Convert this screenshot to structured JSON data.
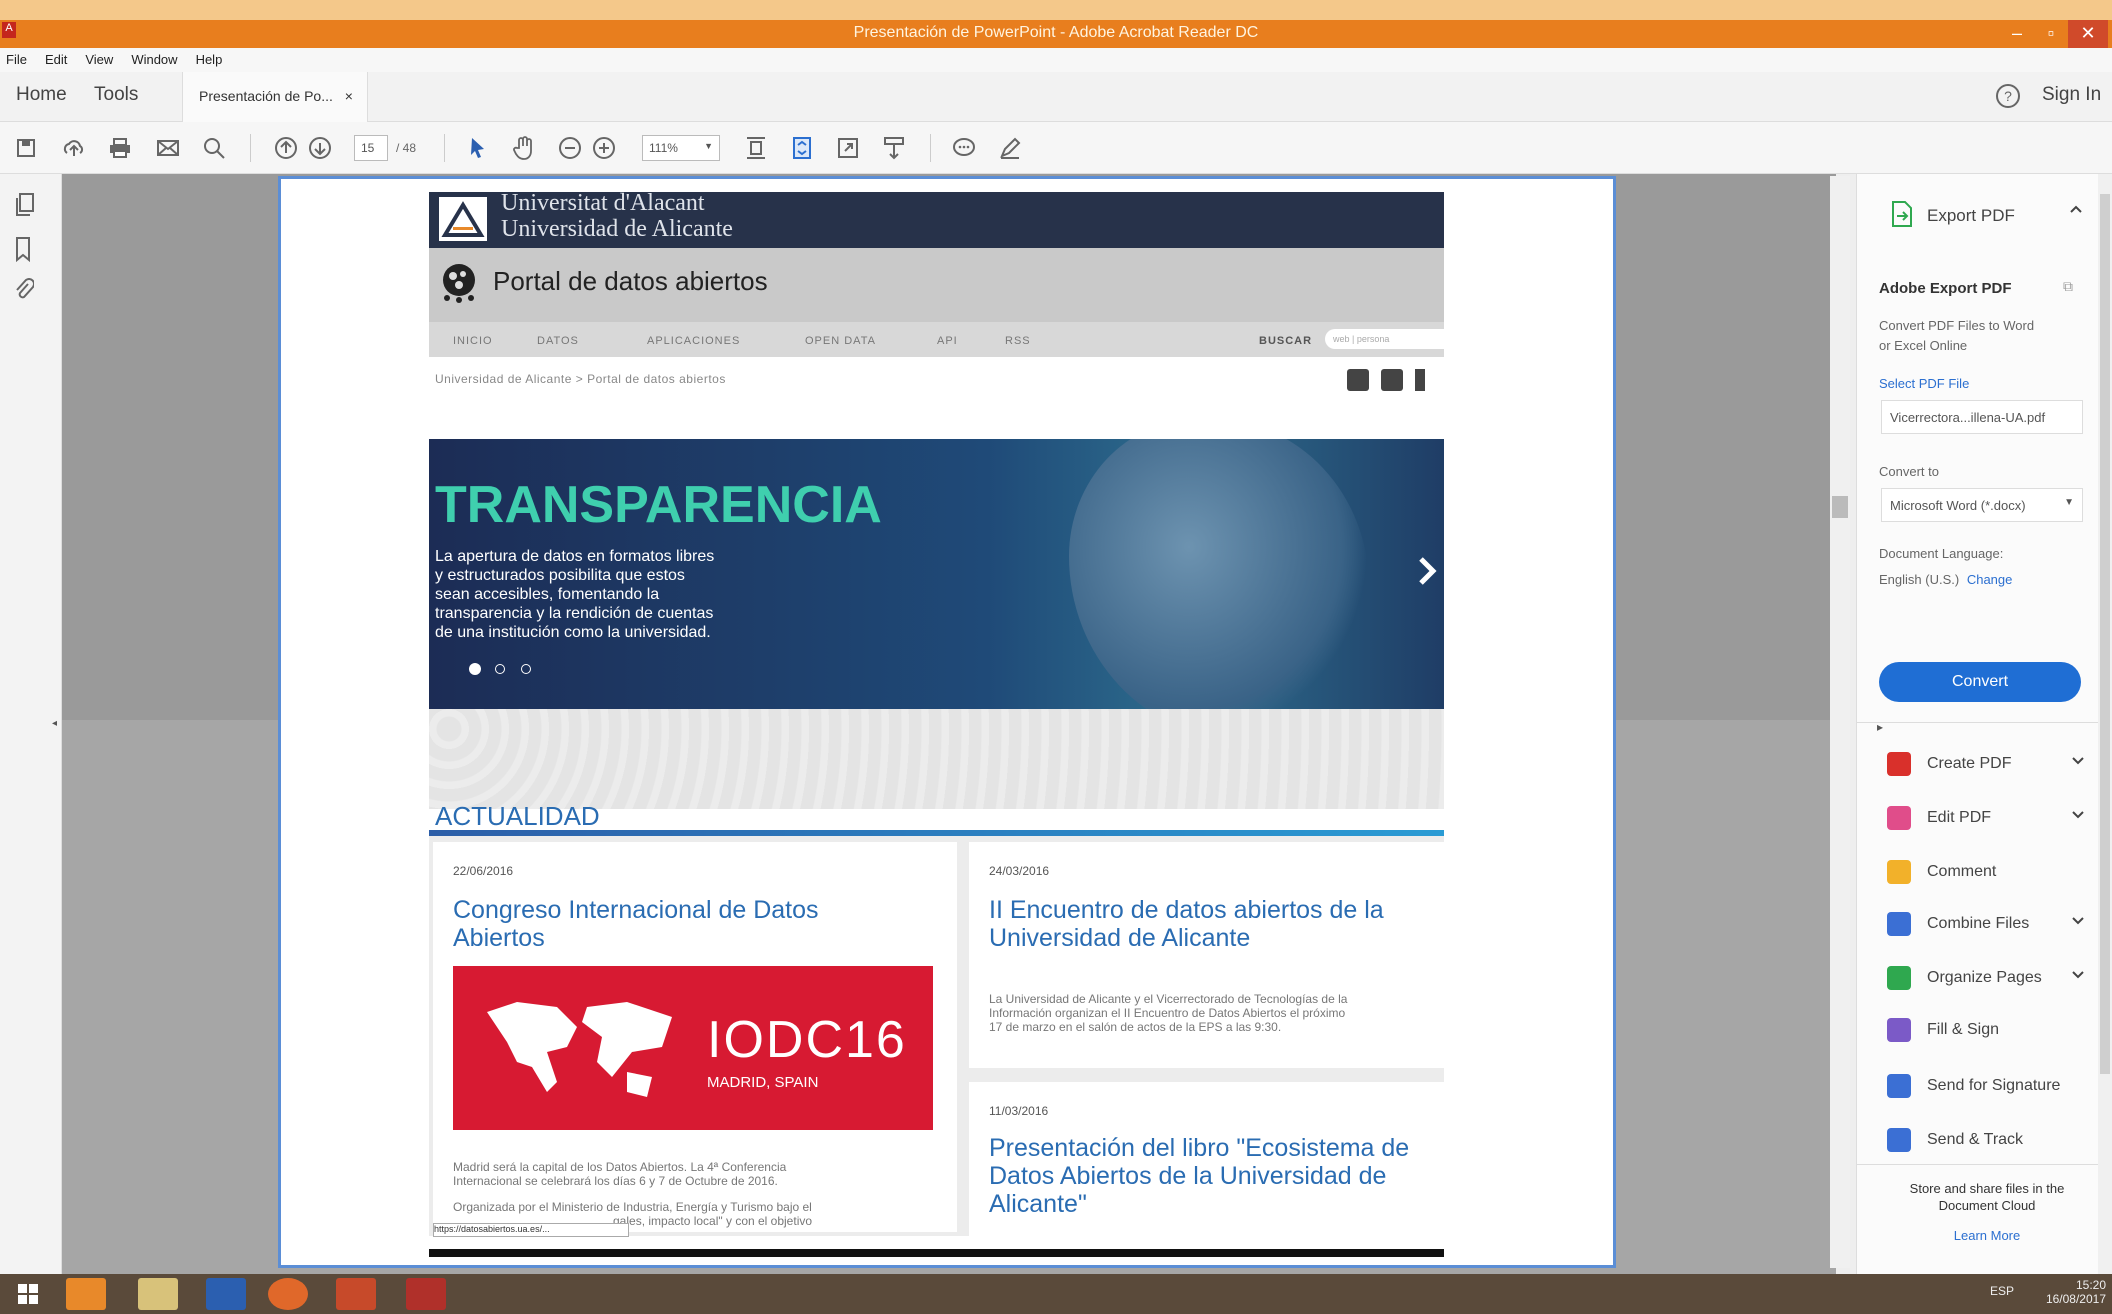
{
  "window": {
    "title": "Presentación de PowerPoint - Adobe Acrobat Reader DC",
    "min": "–",
    "max": "▫",
    "close": "✕"
  },
  "menu": [
    "File",
    "Edit",
    "View",
    "Window",
    "Help"
  ],
  "tabs": {
    "home": "Home",
    "tools": "Tools",
    "doc_tab": "Presentación de Po...",
    "doc_tab_close": "×",
    "help": "?",
    "signin": "Sign In"
  },
  "toolbar": {
    "page_current": "15",
    "page_total": "/ 48",
    "zoom": "111%"
  },
  "web": {
    "univ_line1": "Universitat d'Alacant",
    "univ_line2": "Universidad de Alicante",
    "portal_title": "Portal de datos abiertos",
    "nav": [
      "INICIO",
      "DATOS",
      "APLICACIONES",
      "OPEN DATA",
      "API",
      "RSS"
    ],
    "buscar": "BUSCAR",
    "search_placeholder": "web | persona",
    "breadcrumb": "Universidad de Alicante > Portal de datos abiertos",
    "hero_title": "TRANSPARENCIA",
    "hero_text": [
      "La apertura de datos en formatos libres",
      "y estructurados posibilita que estos",
      "sean accesibles, fomentando la",
      "transparencia y la rendición de cuentas",
      "de una institución como la universidad."
    ],
    "section_title": "ACTUALIDAD",
    "news": [
      {
        "date": "22/06/2016",
        "title": "Congreso Internacional de Datos Abiertos",
        "text": [
          "Madrid será la capital de los Datos Abiertos. La 4ª Conferencia",
          "Internacional se celebrará los días 6 y 7 de Octubre de 2016.",
          "Organizada por el Ministerio de Industria, Energía y Turismo bajo el",
          "...gales, impacto local\" y con el objetivo"
        ]
      },
      {
        "date": "24/03/2016",
        "title": "II Encuentro de datos abiertos de la Universidad de Alicante",
        "text": [
          "La Universidad de Alicante y el Vicerrectorado de Tecnologías de la",
          "Información organizan el II Encuentro de Datos Abiertos el próximo",
          "17 de marzo en el salón de actos de la EPS a las 9:30."
        ]
      },
      {
        "date": "11/03/2016",
        "title": "Presentación del libro \"Ecosistema de Datos Abiertos de la Universidad de Alicante\""
      }
    ],
    "iodc": {
      "brand": "IODC16",
      "place": "MADRID, SPAIN"
    },
    "status_url": "https://datosabiertos.ua.es/..."
  },
  "right_panel": {
    "export_title": "Export PDF",
    "adobe_export_title": "Adobe Export PDF",
    "adobe_export_desc": [
      "Convert PDF Files to Word",
      "or Excel Online"
    ],
    "select_label": "Select PDF File",
    "selected_file": "Vicerrectora...illena-UA.pdf",
    "convert_to_label": "Convert to",
    "convert_to_value": "Microsoft Word (*.docx)",
    "doc_lang_label": "Document Language:",
    "doc_lang_value": "English (U.S.)",
    "change_link": "Change",
    "convert_button": "Convert",
    "tools": [
      {
        "label": "Create PDF",
        "icon": "create-pdf-icon",
        "color": "#d9302b",
        "chevron": true
      },
      {
        "label": "Edit PDF",
        "icon": "edit-pdf-icon",
        "color": "#e04d8a",
        "chevron": true
      },
      {
        "label": "Comment",
        "icon": "comment-icon",
        "color": "#f2b12a",
        "chevron": false
      },
      {
        "label": "Combine Files",
        "icon": "combine-files-icon",
        "color": "#3b6fd4",
        "chevron": true
      },
      {
        "label": "Organize Pages",
        "icon": "organize-pages-icon",
        "color": "#2fa84f",
        "chevron": true
      },
      {
        "label": "Fill & Sign",
        "icon": "fill-sign-icon",
        "color": "#7b5ac7",
        "chevron": false
      },
      {
        "label": "Send for Signature",
        "icon": "send-signature-icon",
        "color": "#3b6fd4",
        "chevron": false
      },
      {
        "label": "Send & Track",
        "icon": "send-track-icon",
        "color": "#3b6fd4",
        "chevron": false
      }
    ],
    "cloud_text": [
      "Store and share files in the",
      "Document Cloud"
    ],
    "learn_more": "Learn More"
  },
  "taskbar": {
    "time": "15:20",
    "date": "16/08/2017",
    "lang": "ESP"
  }
}
